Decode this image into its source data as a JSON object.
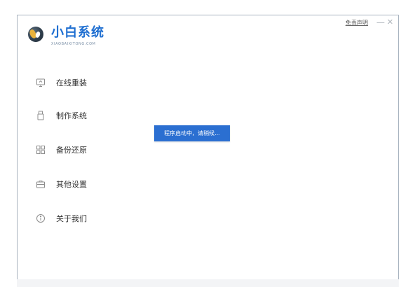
{
  "app": {
    "title": "小白系统",
    "subtitle": "XIAOBAIXITONG.COM"
  },
  "header": {
    "disclaimer": "免责声明",
    "minimize_glyph": "—",
    "close_glyph": "✕"
  },
  "sidebar": {
    "items": [
      {
        "label": "在线重装",
        "icon": "monitor-icon"
      },
      {
        "label": "制作系统",
        "icon": "usb-drive-icon"
      },
      {
        "label": "备份还原",
        "icon": "grid-icon"
      },
      {
        "label": "其他设置",
        "icon": "toolbox-icon"
      },
      {
        "label": "关于我们",
        "icon": "info-icon"
      }
    ]
  },
  "toast": {
    "message": "程序启动中，请稍候..."
  },
  "colors": {
    "brand": "#1f6fd1",
    "toast_bg": "#2b6fd1",
    "icon": "#8c8c8c"
  }
}
